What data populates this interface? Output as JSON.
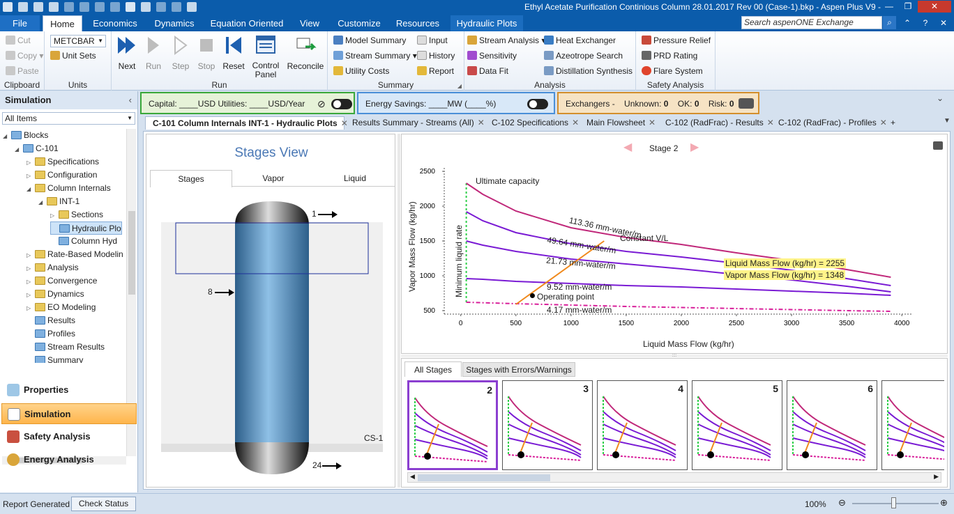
{
  "window": {
    "title": "Ethyl Acetate Purification Continious Column 28.01.2017 Rev 00 (Case-1).bkp - Aspen Plus V9 -",
    "minimize": "—",
    "restore": "❐",
    "close": "✕"
  },
  "ribbon_tabs": [
    "File",
    "Home",
    "Economics",
    "Dynamics",
    "Equation Oriented",
    "View",
    "Customize",
    "Resources",
    "Hydraulic Plots"
  ],
  "search": {
    "placeholder": "Search aspenONE Exchange"
  },
  "clipboard": {
    "cut": "Cut",
    "copy": "Copy",
    "paste": "Paste",
    "label": "Clipboard"
  },
  "units": {
    "set": "METCBAR",
    "unit_sets": "Unit Sets",
    "label": "Units"
  },
  "run": {
    "next": "Next",
    "run": "Run",
    "step": "Step",
    "stop": "Stop",
    "reset": "Reset",
    "control_panel_1": "Control",
    "control_panel_2": "Panel",
    "reconcile": "Reconcile",
    "label": "Run"
  },
  "summary": {
    "model_summary": "Model Summary",
    "input": "Input",
    "stream_summary": "Stream Summary",
    "history": "History",
    "utility_costs": "Utility Costs",
    "report": "Report",
    "label": "Summary"
  },
  "analysis": {
    "stream_analysis": "Stream Analysis",
    "heat_exchanger": "Heat Exchanger",
    "sensitivity": "Sensitivity",
    "azeotrope": "Azeotrope Search",
    "data_fit": "Data Fit",
    "distillation": "Distillation Synthesis",
    "label": "Analysis"
  },
  "safety": {
    "pressure_relief": "Pressure Relief",
    "prd_rating": "PRD Rating",
    "flare_system": "Flare System",
    "label": "Safety Analysis"
  },
  "costs": {
    "capital": "Capital: ____USD   Utilities: ____USD/Year",
    "energy": "Energy Savings: ____MW    (____%)",
    "exchangers_label": "Exchangers -",
    "unknown_label": "Unknown:",
    "unknown": "0",
    "ok_label": "OK:",
    "ok": "0",
    "risk_label": "Risk:",
    "risk": "0"
  },
  "nav": {
    "title": "Simulation",
    "filter": "All Items",
    "tree": [
      {
        "label": "Blocks",
        "level": 0,
        "exp": "◢",
        "type": "blue"
      },
      {
        "label": "C-101",
        "level": 1,
        "exp": "◢",
        "type": "blue"
      },
      {
        "label": "Specifications",
        "level": 2,
        "exp": "▷",
        "type": "folder"
      },
      {
        "label": "Configuration",
        "level": 2,
        "exp": "▷",
        "type": "folder"
      },
      {
        "label": "Column Internals",
        "level": 2,
        "exp": "◢",
        "type": "folder"
      },
      {
        "label": "INT-1",
        "level": 3,
        "exp": "◢",
        "type": "folder"
      },
      {
        "label": "Sections",
        "level": 4,
        "exp": "▷",
        "type": "folder"
      },
      {
        "label": "Hydraulic Plo",
        "level": 4,
        "exp": "",
        "type": "blue",
        "sel": true
      },
      {
        "label": "Column Hyd",
        "level": 4,
        "exp": "",
        "type": "blue"
      },
      {
        "label": "Rate-Based Modelin",
        "level": 2,
        "exp": "▷",
        "type": "folder"
      },
      {
        "label": "Analysis",
        "level": 2,
        "exp": "▷",
        "type": "folder"
      },
      {
        "label": "Convergence",
        "level": 2,
        "exp": "▷",
        "type": "folder"
      },
      {
        "label": "Dynamics",
        "level": 2,
        "exp": "▷",
        "type": "folder"
      },
      {
        "label": "EO Modeling",
        "level": 2,
        "exp": "▷",
        "type": "folder"
      },
      {
        "label": "Results",
        "level": 2,
        "exp": "",
        "type": "blue"
      },
      {
        "label": "Profiles",
        "level": 2,
        "exp": "",
        "type": "blue"
      },
      {
        "label": "Stream Results",
        "level": 2,
        "exp": "",
        "type": "blue"
      },
      {
        "label": "Summary",
        "level": 2,
        "exp": "",
        "type": "blue"
      }
    ],
    "buttons": [
      {
        "label": "Properties",
        "icon": "flask-icon"
      },
      {
        "label": "Simulation",
        "icon": "flowsheet-icon"
      },
      {
        "label": "Safety Analysis",
        "icon": "safety-icon"
      },
      {
        "label": "Energy Analysis",
        "icon": "energy-icon"
      }
    ]
  },
  "doc_tabs": [
    "C-101 Column Internals INT-1 - Hydraulic Plots",
    "Results Summary - Streams (All)",
    "C-102 Specifications",
    "Main Flowsheet",
    "C-102 (RadFrac) - Results",
    "C-102 (RadFrac) - Profiles"
  ],
  "stages_view": {
    "title": "Stages View",
    "tabs": [
      "Stages",
      "Vapor",
      "Liquid"
    ],
    "streams": {
      "top": "1",
      "feed": "8",
      "bottom": "24"
    },
    "section": "CS-1"
  },
  "plot": {
    "stage_label": "Stage 2",
    "xlabel": "Liquid Mass Flow (kg/hr)",
    "ylabel": "Vapor Mass Flow (kg/hr)",
    "xticks": [
      "0",
      "500",
      "1000",
      "1500",
      "2000",
      "2500",
      "3000",
      "3500",
      "4000"
    ],
    "yticks": [
      "500",
      "1000",
      "1500",
      "2000",
      "2500"
    ],
    "labels": {
      "ultimate": "Ultimate capacity",
      "constant_vl": "Constant V/L",
      "min_liquid": "Minimum liquid rate",
      "operating": "Operating point",
      "c1": "113.36 mm-water/m",
      "c2": "49.64 mm-water/m",
      "c3": "21.73 mm-water/m",
      "c4": "9.52 mm-water/m",
      "c5": "4.17 mm-water/m",
      "tip1": "Liquid Mass Flow (kg/hr) = 2255",
      "tip2": "Vapor Mass Flow (kg/hr) = 1348"
    }
  },
  "chart_data": {
    "type": "line",
    "title": "",
    "xlabel": "Liquid Mass Flow (kg/hr)",
    "ylabel": "Vapor Mass Flow (kg/hr)",
    "xlim": [
      -150,
      4100
    ],
    "ylim": [
      450,
      2550
    ],
    "series": [
      {
        "name": "113.36 mm-water/m",
        "color": "#c0287a",
        "x": [
          50,
          200,
          500,
          1000,
          1500,
          2000,
          2500,
          3000,
          3500,
          3900
        ],
        "values": [
          2330,
          2170,
          1930,
          1690,
          1550,
          1450,
          1330,
          1220,
          1090,
          980
        ]
      },
      {
        "name": "49.64 mm-water/m",
        "color": "#7a1bd4",
        "x": [
          50,
          200,
          500,
          1000,
          1500,
          2000,
          2500,
          3000,
          3500,
          3900
        ],
        "values": [
          1920,
          1790,
          1620,
          1460,
          1350,
          1270,
          1180,
          1080,
          960,
          860
        ]
      },
      {
        "name": "21.73 mm-water/m",
        "color": "#7a1bd4",
        "x": [
          50,
          200,
          500,
          1000,
          1500,
          2000,
          2500,
          3000,
          3500,
          3900
        ],
        "values": [
          1500,
          1440,
          1350,
          1240,
          1170,
          1100,
          1020,
          940,
          850,
          770
        ]
      },
      {
        "name": "9.52 mm-water/m",
        "color": "#7a1bd4",
        "x": [
          50,
          200,
          500,
          1000,
          1500,
          2000,
          2500,
          3000,
          3500,
          3900
        ],
        "values": [
          960,
          950,
          920,
          890,
          860,
          840,
          810,
          780,
          750,
          720
        ]
      },
      {
        "name": "4.17 mm-water/m",
        "color": "#d81f9a",
        "x": [
          50,
          500,
          1000,
          1500,
          2000,
          2500,
          3000,
          3500,
          3900
        ],
        "values": [
          620,
          600,
          580,
          560,
          545,
          530,
          515,
          500,
          490
        ]
      },
      {
        "name": "Constant V/L",
        "color": "#f08a1e",
        "x": [
          500,
          1300
        ],
        "values": [
          590,
          1500
        ]
      }
    ],
    "minimum_liquid_rate": {
      "x": 50,
      "ymin": 620,
      "ymax": 2330
    },
    "operating_point": {
      "x": 650,
      "y": 715
    },
    "hover": {
      "x": 2255,
      "y": 1348
    }
  },
  "stage_tabs": [
    "All Stages",
    "Stages with Errors/Warnings"
  ],
  "thumbnails": [
    "2",
    "3",
    "4",
    "5",
    "6"
  ],
  "status": {
    "report": "Report Generated",
    "check": "Check Status",
    "zoom": "100%"
  }
}
